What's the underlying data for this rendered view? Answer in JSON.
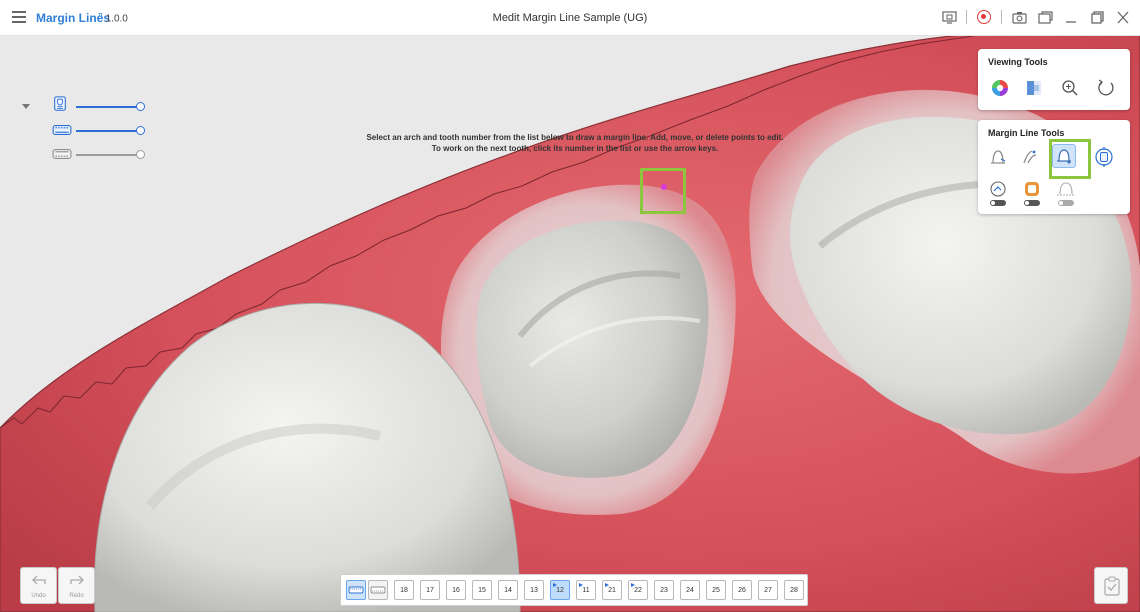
{
  "titlebar": {
    "app_name": "Margin Lines",
    "app_version_sup": "π",
    "app_version": "1.0.0",
    "window_title": "Medit Margin Line Sample (UG)"
  },
  "instruction": {
    "line1": "Select an arch and tooth number from the list below to draw a margin line. Add, move, or delete points to edit.",
    "line2": "To work on the next tooth, click its number in the list or use the arrow keys."
  },
  "viewing_tools": {
    "title": "Viewing Tools",
    "tools": [
      "color-wheel-icon",
      "texture-icon",
      "zoom-fit-icon",
      "reset-view-icon"
    ]
  },
  "margin_line_tools": {
    "title": "Margin Line Tools",
    "tools_row1": [
      "auto-margin-icon",
      "smart-margin-icon",
      "manual-margin-icon",
      "margin-edit-icon"
    ],
    "tools_row2": [
      "curvature-toggle-icon",
      "occlusion-toggle-icon",
      "undercut-toggle-icon"
    ],
    "toggle_state": "OFF",
    "active_tool": "manual-margin-icon"
  },
  "bottom": {
    "undo_label": "Undo",
    "redo_label": "Redo"
  },
  "teeth": [
    {
      "num": "18",
      "flag": false,
      "selected": false
    },
    {
      "num": "17",
      "flag": false,
      "selected": false
    },
    {
      "num": "16",
      "flag": false,
      "selected": false
    },
    {
      "num": "15",
      "flag": false,
      "selected": false
    },
    {
      "num": "14",
      "flag": false,
      "selected": false
    },
    {
      "num": "13",
      "flag": false,
      "selected": false
    },
    {
      "num": "12",
      "flag": true,
      "selected": true
    },
    {
      "num": "11",
      "flag": true,
      "selected": false
    },
    {
      "num": "21",
      "flag": true,
      "selected": false
    },
    {
      "num": "22",
      "flag": true,
      "selected": false
    },
    {
      "num": "23",
      "flag": false,
      "selected": false
    },
    {
      "num": "24",
      "flag": false,
      "selected": false
    },
    {
      "num": "25",
      "flag": false,
      "selected": false
    },
    {
      "num": "26",
      "flag": false,
      "selected": false
    },
    {
      "num": "27",
      "flag": false,
      "selected": false
    },
    {
      "num": "28",
      "flag": false,
      "selected": false
    }
  ],
  "colors": {
    "accent": "#2f7fd8",
    "gum": "#d8555b",
    "tooth": "#e6e6e4",
    "highlight": "#8cc63f",
    "point": "#d63ad6"
  }
}
